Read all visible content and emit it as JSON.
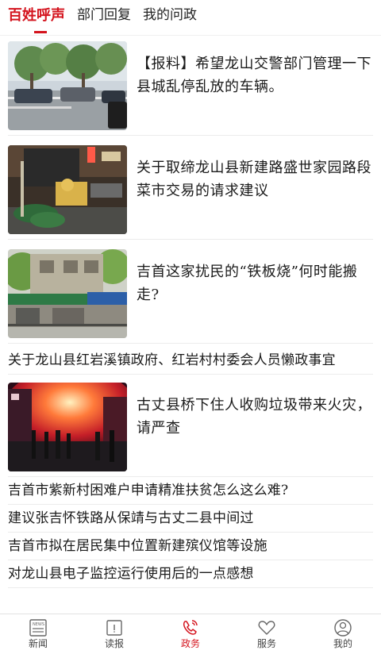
{
  "tabs": [
    {
      "label": "百姓呼声",
      "active": true
    },
    {
      "label": "部门回复",
      "active": false
    },
    {
      "label": "我的问政",
      "active": false
    }
  ],
  "articles_with_image": [
    {
      "title": "【报料】希望龙山交警部门管理一下县城乱停乱放的车辆。",
      "image": "street-cars-photo"
    },
    {
      "title": "关于取缔龙山县新建路盛世家园路段菜市交易的请求建议",
      "image": "night-market-photo"
    },
    {
      "title": "吉首这家扰民的“铁板烧”何时能搬走?",
      "image": "shop-building-photo"
    }
  ],
  "text_after_third": "关于龙山县红岩溪镇政府、红岩村村委会人员懒政事宜",
  "article_fire": {
    "title": "古丈县桥下住人收购垃圾带来火灾，请严查",
    "image": "fire-night-photo"
  },
  "text_articles": [
    "吉首市紫新村困难户申请精准扶贫怎么这么难?",
    "建议张吉怀铁路从保靖与古丈二县中间过",
    "吉首市拟在居民集中位置新建殡仪馆等设施",
    "对龙山县电子监控运行使用后的一点感想"
  ],
  "bottom_nav": [
    {
      "label": "新闻",
      "icon": "newspaper-icon",
      "active": false
    },
    {
      "label": "读报",
      "icon": "reader-icon",
      "active": false
    },
    {
      "label": "政务",
      "icon": "phone-icon",
      "active": true
    },
    {
      "label": "服务",
      "icon": "heart-icon",
      "active": false
    },
    {
      "label": "我的",
      "icon": "user-icon",
      "active": false
    }
  ],
  "colors": {
    "accent": "#d4141e",
    "text": "#1a1a1a",
    "divider": "#ececec"
  }
}
